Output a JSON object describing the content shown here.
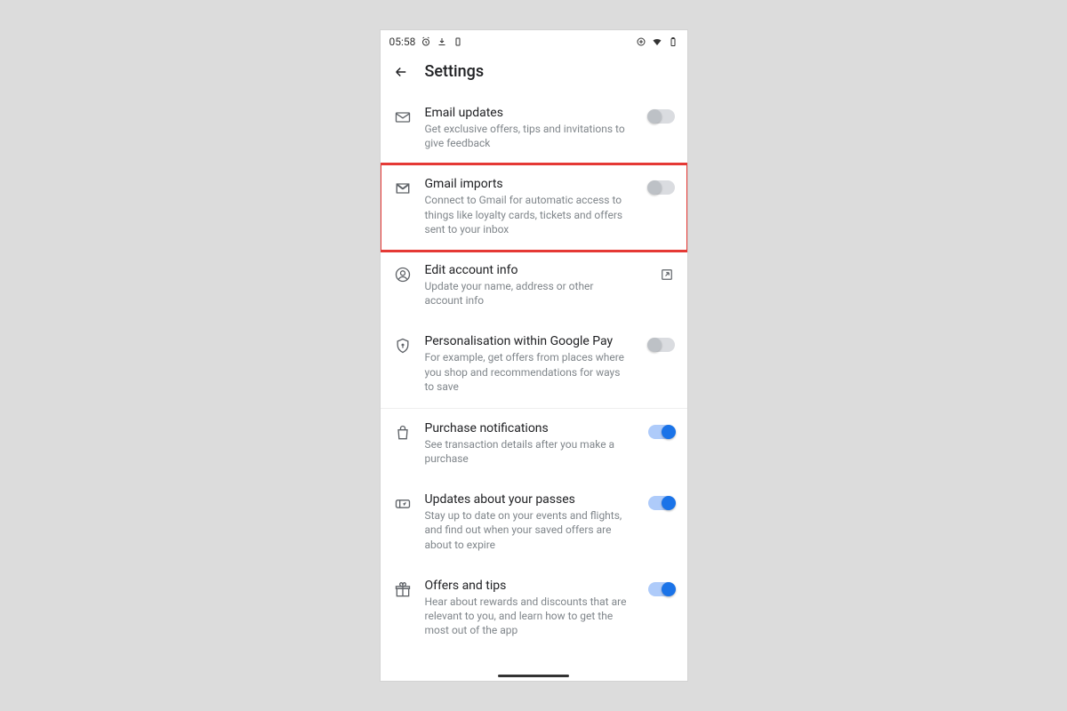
{
  "statusbar": {
    "time": "05:58"
  },
  "header": {
    "title": "Settings"
  },
  "rows": [
    {
      "icon": "mail-icon",
      "title": "Email updates",
      "desc": "Get exclusive offers, tips and invitations to give feedback",
      "trailing": "switch-off",
      "highlight": false
    },
    {
      "icon": "gmail-icon",
      "title": "Gmail imports",
      "desc": "Connect to Gmail for automatic access to things like loyalty cards, tickets and offers sent to your inbox",
      "trailing": "switch-off",
      "highlight": true
    },
    {
      "icon": "account-icon",
      "title": "Edit account info",
      "desc": "Update your name, address or other account info",
      "trailing": "open-external",
      "highlight": false
    },
    {
      "icon": "shield-icon",
      "title": "Personalisation within Google Pay",
      "desc": "For example, get offers from places where you shop and recommendations for ways to save",
      "trailing": "switch-off",
      "highlight": false
    },
    {
      "icon": "bag-icon",
      "title": "Purchase notifications",
      "desc": "See transaction details after you make a purchase",
      "trailing": "switch-on",
      "highlight": false
    },
    {
      "icon": "ticket-icon",
      "title": "Updates about your passes",
      "desc": "Stay up to date on your events and flights, and find out when your saved offers are about to expire",
      "trailing": "switch-on",
      "highlight": false
    },
    {
      "icon": "gift-icon",
      "title": "Offers and tips",
      "desc": "Hear about rewards and discounts that are relevant to you, and learn how to get the most out of the app",
      "trailing": "switch-on",
      "highlight": false
    }
  ],
  "group_break_after": 3
}
